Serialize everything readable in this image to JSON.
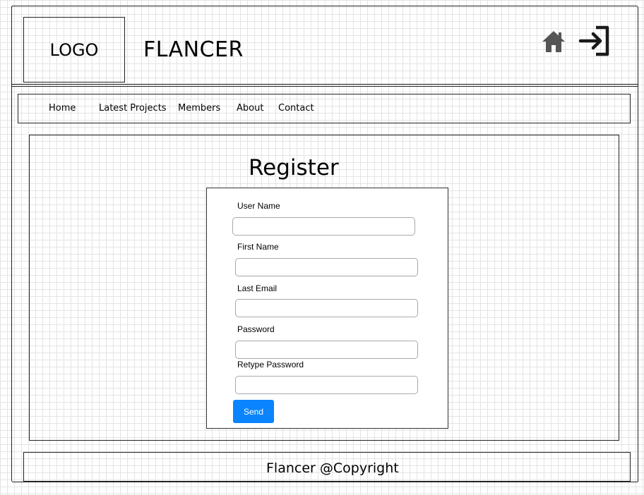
{
  "header": {
    "logo_text": "LOGO",
    "app_title": "FLANCER",
    "icons": [
      "home-icon",
      "login-icon"
    ]
  },
  "nav": {
    "items": [
      {
        "label": "Home"
      },
      {
        "label": "Latest Projects"
      },
      {
        "label": "Members"
      },
      {
        "label": "About"
      },
      {
        "label": "Contact"
      }
    ]
  },
  "register": {
    "title": "Register",
    "fields": [
      {
        "label": "User Name",
        "value": ""
      },
      {
        "label": "First Name",
        "value": ""
      },
      {
        "label": "Last Email",
        "value": ""
      },
      {
        "label": "Password",
        "value": ""
      },
      {
        "label": "Retype Password",
        "value": ""
      }
    ],
    "send_label": "Send"
  },
  "footer": {
    "text": "Flancer @Copyright"
  },
  "colors": {
    "accent": "#0a84ff",
    "icon": "#555555"
  }
}
